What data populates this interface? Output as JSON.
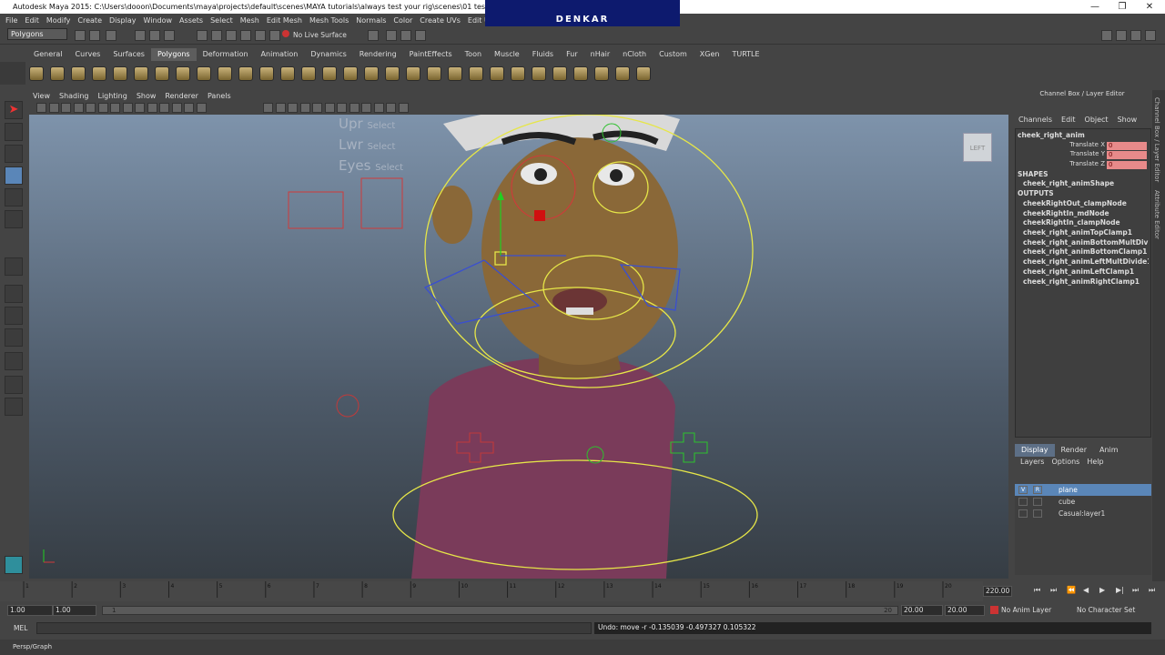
{
  "window": {
    "title": "Autodesk Maya 2015: C:\\Users\\dooon\\Documents\\maya\\projects\\default\\scenes\\MAYA tutorials\\always test your rig\\scenes\\01 test rig.0001.mb*",
    "minimize": "—",
    "maximize": "❐",
    "close": "✕"
  },
  "logo": {
    "text": "DENKAR"
  },
  "menu": [
    "File",
    "Edit",
    "Modify",
    "Create",
    "Display",
    "Window",
    "Assets",
    "Select",
    "Mesh",
    "Edit Mesh",
    "Mesh Tools",
    "Normals",
    "Color",
    "Create UVs",
    "Edit UVs",
    "Muscle"
  ],
  "status": {
    "mode": "Polygons",
    "live_surface": "No Live Surface"
  },
  "shelf_tabs": [
    "General",
    "Curves",
    "Surfaces",
    "Polygons",
    "Deformation",
    "Animation",
    "Dynamics",
    "Rendering",
    "PaintEffects",
    "Toon",
    "Muscle",
    "Fluids",
    "Fur",
    "nHair",
    "nCloth",
    "Custom",
    "XGen",
    "TURTLE"
  ],
  "shelf_active": "Polygons",
  "viewport_menu": [
    "View",
    "Shading",
    "Lighting",
    "Show",
    "Renderer",
    "Panels"
  ],
  "viewport": {
    "cube_label": "LEFT",
    "hud": [
      {
        "key": "Upr",
        "action": "Select"
      },
      {
        "key": "Lwr",
        "action": "Select"
      },
      {
        "key": "Eyes",
        "action": "Select"
      }
    ],
    "camera": "Persp/Graph"
  },
  "channel_box": {
    "title": "Channel Box / Layer Editor",
    "menu": [
      "Channels",
      "Edit",
      "Object",
      "Show"
    ],
    "node": "cheek_right_anim",
    "attrs": [
      {
        "label": "Translate X",
        "value": "0"
      },
      {
        "label": "Translate Y",
        "value": "0"
      },
      {
        "label": "Translate Z",
        "value": "0"
      }
    ],
    "shapes_header": "SHAPES",
    "shape": "cheek_right_animShape",
    "outputs_header": "OUTPUTS",
    "outputs": [
      "cheekRightOut_clampNode",
      "cheekRightIn_mdNode",
      "cheekRightIn_clampNode",
      "cheek_right_animTopClamp1",
      "cheek_right_animBottomMultDivi...",
      "cheek_right_animBottomClamp1",
      "cheek_right_animLeftMultDivide1",
      "cheek_right_animLeftClamp1",
      "cheek_right_animRightClamp1"
    ]
  },
  "side_tabs": [
    "Channel Box / Layer Editor",
    "Attribute Editor"
  ],
  "layer_editor": {
    "tabs": [
      "Display",
      "Render",
      "Anim"
    ],
    "active_tab": "Display",
    "menu": [
      "Layers",
      "Options",
      "Help"
    ],
    "layers": [
      {
        "name": "plane",
        "v": "V",
        "r": "R",
        "selected": true
      },
      {
        "name": "cube",
        "v": "",
        "r": "",
        "selected": false
      },
      {
        "name": "Casual:layer1",
        "v": "",
        "r": "",
        "selected": false
      }
    ]
  },
  "timeline": {
    "ticks": [
      "1",
      "2",
      "3",
      "4",
      "5",
      "6",
      "7",
      "8",
      "9",
      "10",
      "11",
      "12",
      "13",
      "14",
      "15",
      "16",
      "17",
      "18",
      "19",
      "20"
    ],
    "current_frame": "220.00"
  },
  "range": {
    "start": "1.00",
    "playback_start": "1.00",
    "slider_start": "1",
    "slider_end": "20",
    "playback_end": "20.00",
    "end": "20.00",
    "anim_layer": "No Anim Layer",
    "character_set": "No Character Set"
  },
  "command": {
    "label": "MEL",
    "feedback": "Undo: move -r -0.135039 -0.497327 0.105322"
  },
  "help": {
    "text": "Persp/Graph"
  },
  "colors": {
    "accent": "#5a86b8",
    "keyed": "#e88a8a"
  }
}
